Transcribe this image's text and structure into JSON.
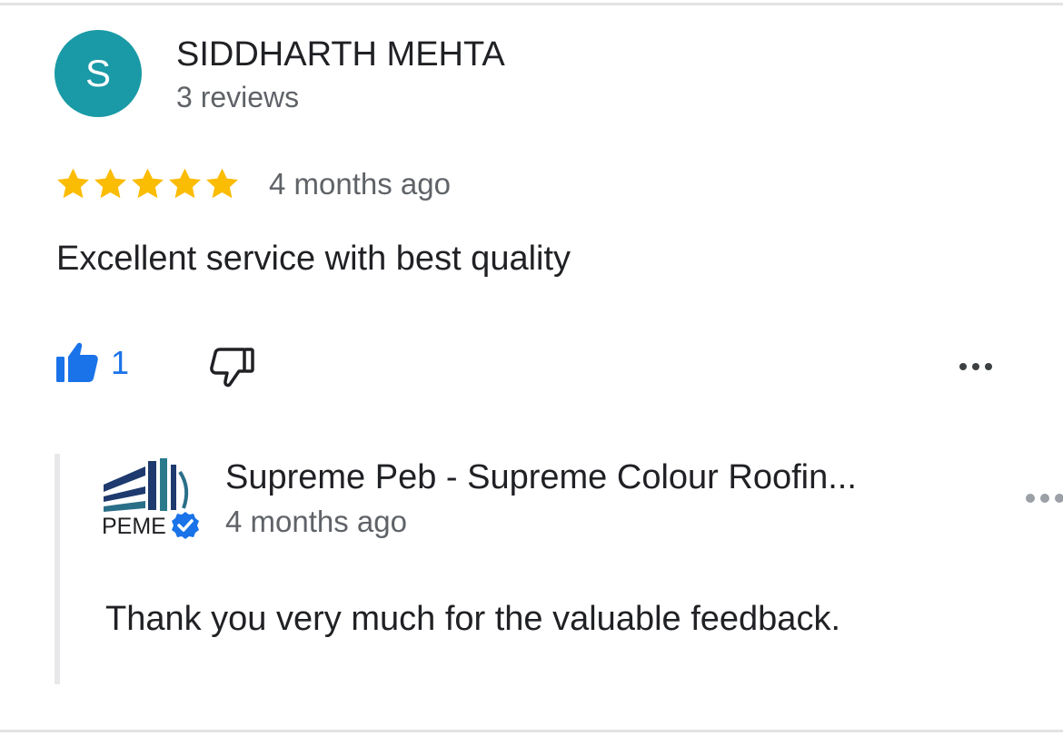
{
  "review": {
    "author": {
      "initial": "S",
      "name": "SIDDHARTH MEHTA",
      "review_count": "3 reviews",
      "avatar_color": "#1a9aa6"
    },
    "rating": 5,
    "rating_max": 5,
    "star_color": "#fbbc04",
    "time": "4 months ago",
    "text": "Excellent service with best quality",
    "actions": {
      "like_count": "1",
      "like_icon": "thumbs-up-filled-icon",
      "dislike_icon": "thumbs-down-outline-icon",
      "more_icon": "more-horizontal-icon",
      "accent_color": "#1a73e8"
    }
  },
  "owner_reply": {
    "name": "Supreme Peb - Supreme Colour Roofin...",
    "time": "4 months ago",
    "text": "Thank you very much for the valuable feedback.",
    "logo": {
      "text": "PEME",
      "colors": [
        "#1e3a6e",
        "#2a7a8c"
      ],
      "verified_icon": "verified-badge-icon",
      "verified_color": "#1a73e8"
    },
    "more_icon": "more-horizontal-icon"
  }
}
